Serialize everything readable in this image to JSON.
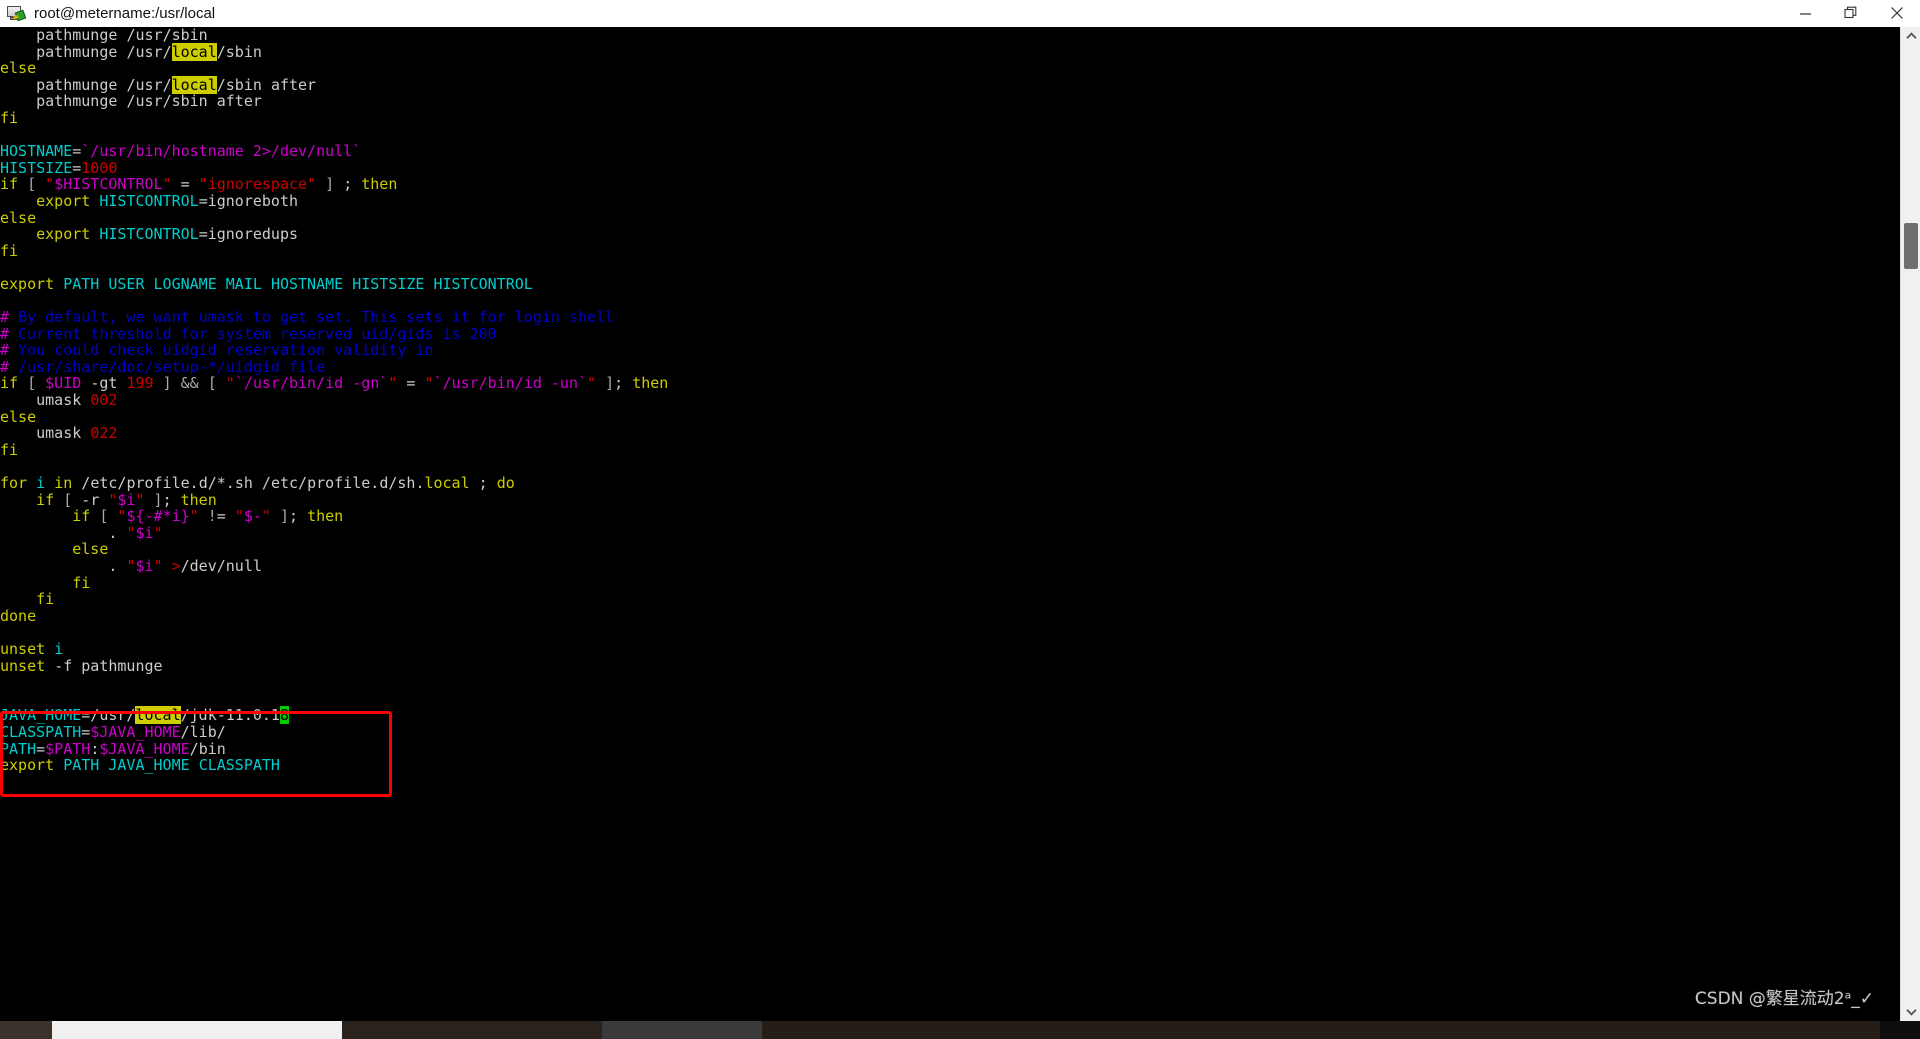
{
  "window": {
    "title": "root@metername:/usr/local",
    "icon": "terminal-putty-icon",
    "controls": {
      "minimize": "–",
      "maximize": "❐",
      "close": "✕"
    }
  },
  "terminal": {
    "background": "#000000",
    "foreground": "#cccccc",
    "search_highlight_color": "#cdcd00",
    "cursor_highlight_color": "#00cd00",
    "annotation_box_color": "#ff0000",
    "lines": [
      "    pathmunge /usr/sbin",
      "    pathmunge /usr/local/sbin",
      "else",
      "    pathmunge /usr/local/sbin after",
      "    pathmunge /usr/sbin after",
      "fi",
      "",
      "HOSTNAME=`/usr/bin/hostname 2>/dev/null`",
      "HISTSIZE=1000",
      "if [ \"$HISTCONTROL\" = \"ignorespace\" ] ; then",
      "    export HISTCONTROL=ignoreboth",
      "else",
      "    export HISTCONTROL=ignoredups",
      "fi",
      "",
      "export PATH USER LOGNAME MAIL HOSTNAME HISTSIZE HISTCONTROL",
      "",
      "# By default, we want umask to get set. This sets it for login shell",
      "# Current threshold for system reserved uid/gids is 200",
      "# You could check uidgid reservation validity in",
      "# /usr/share/doc/setup-*/uidgid file",
      "if [ $UID -gt 199 ] && [ \"`/usr/bin/id -gn`\" = \"`/usr/bin/id -un`\" ]; then",
      "    umask 002",
      "else",
      "    umask 022",
      "fi",
      "",
      "for i in /etc/profile.d/*.sh /etc/profile.d/sh.local ; do",
      "    if [ -r \"$i\" ]; then",
      "        if [ \"${-#*i}\" != \"$-\" ]; then",
      "            . \"$i\"",
      "        else",
      "            . \"$i\" >/dev/null",
      "        fi",
      "    fi",
      "done",
      "",
      "unset i",
      "unset -f pathmunge",
      "",
      "",
      "JAVA_HOME=/usr/local/jdk-11.0.18",
      "CLASSPATH=$JAVA_HOME/lib/",
      "PATH=$PATH:$JAVA_HOME/bin",
      "export PATH JAVA_HOME CLASSPATH"
    ],
    "search_term": "local",
    "cursor_char": "8",
    "java_home_value": "/usr/local/jdk-11.0.18",
    "classpath_value": "$JAVA_HOME/lib/",
    "path_value": "$PATH:$JAVA_HOME/bin",
    "export_vars": "PATH JAVA_HOME CLASSPATH"
  },
  "watermark": {
    "text": "CSDN @繁星流动2ᵃ_✓"
  },
  "scrollbars": {
    "vertical": {
      "up_arrow": "▲",
      "down_arrow": "▼"
    },
    "horizontal": {
      "present": true
    }
  }
}
